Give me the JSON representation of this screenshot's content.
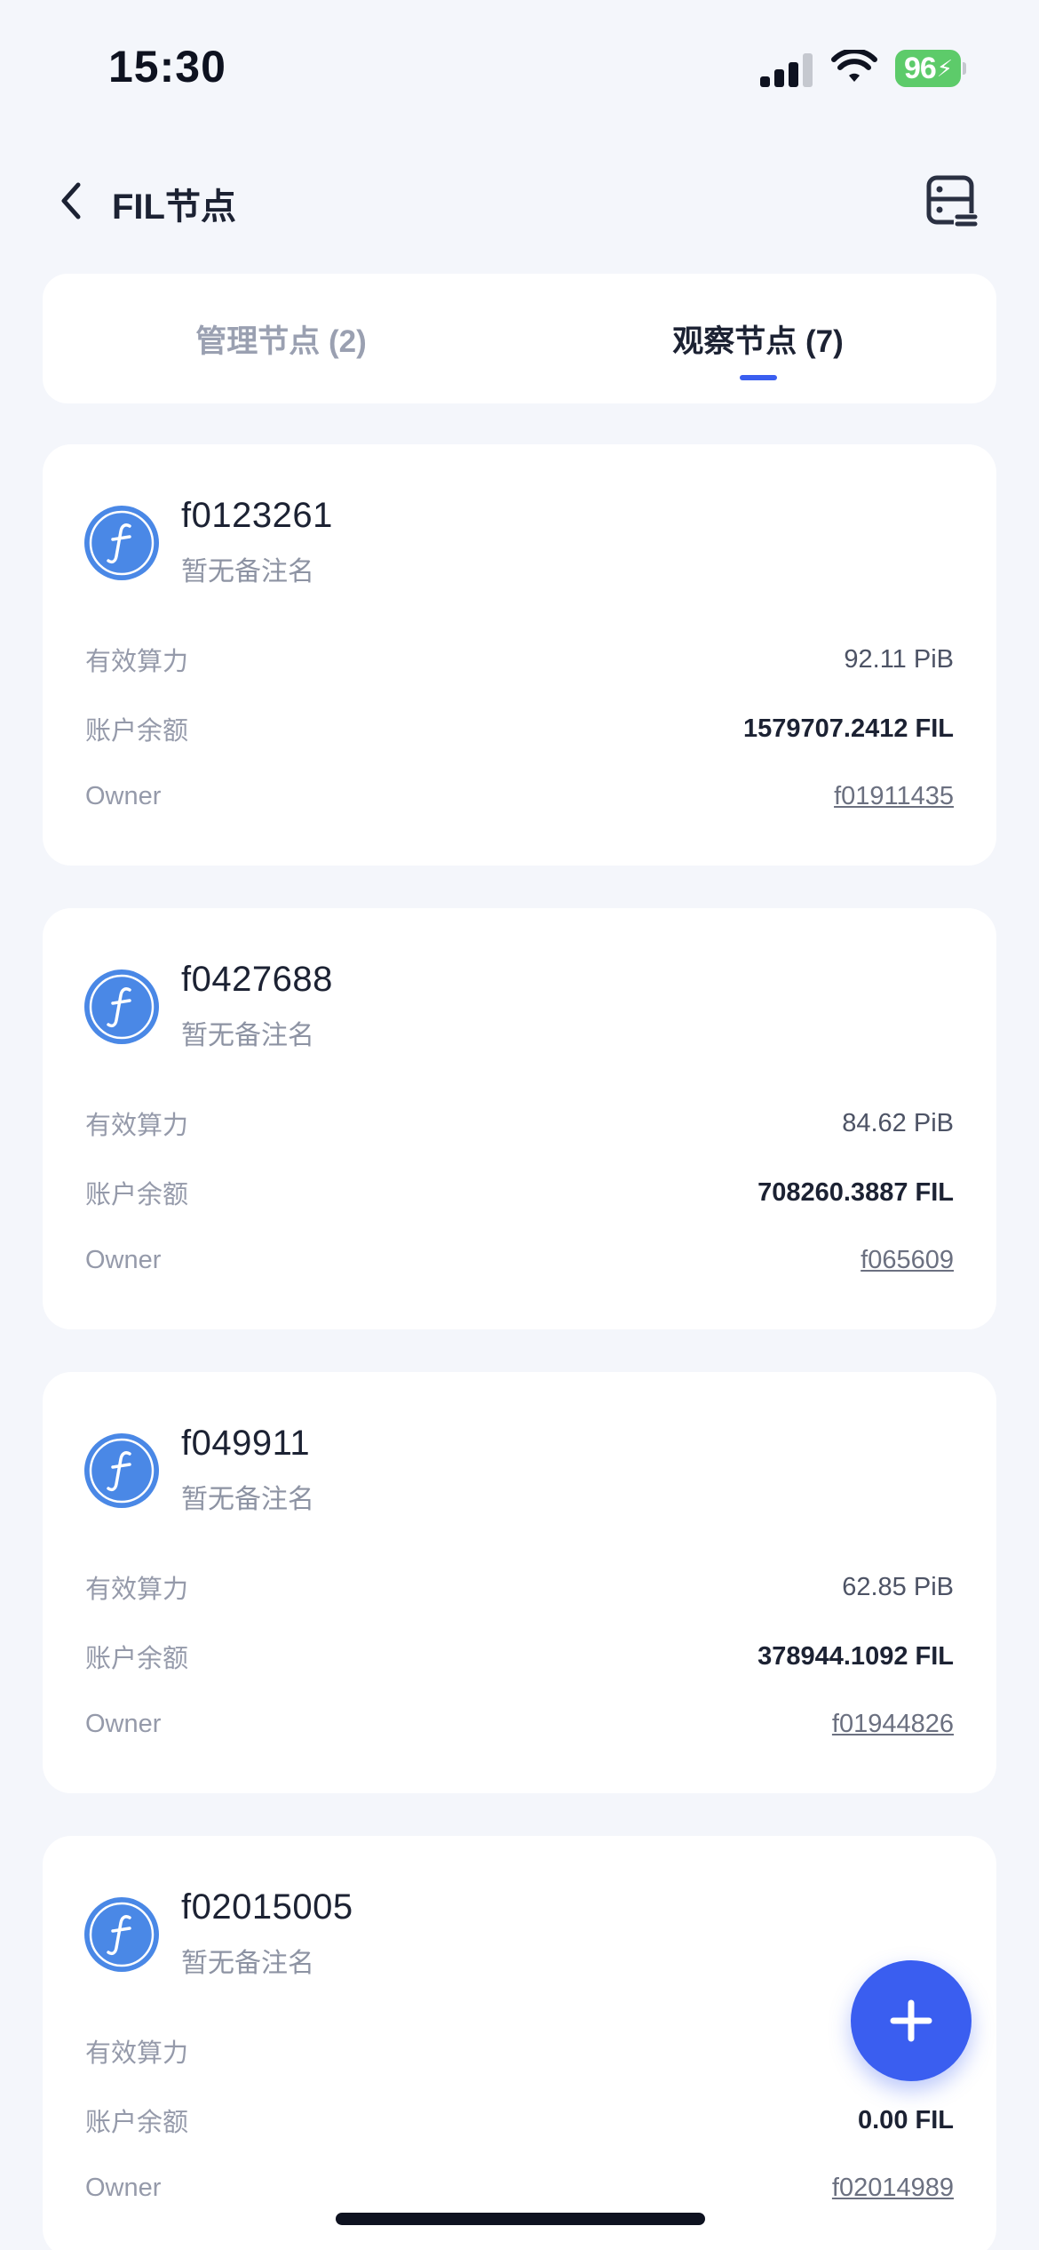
{
  "status_bar": {
    "time": "15:30",
    "battery": "96"
  },
  "header": {
    "title": "FIL节点"
  },
  "tabs": [
    {
      "label": "管理节点 (2)",
      "active": false
    },
    {
      "label": "观察节点 (7)",
      "active": true
    }
  ],
  "row_labels": {
    "power": "有效算力",
    "balance": "账户余额",
    "owner": "Owner"
  },
  "nodes": [
    {
      "id": "f0123261",
      "note": "暂无备注名",
      "power": "92.11 PiB",
      "balance": "1579707.2412 FIL",
      "owner": "f01911435"
    },
    {
      "id": "f0427688",
      "note": "暂无备注名",
      "power": "84.62 PiB",
      "balance": "708260.3887 FIL",
      "owner": "f065609"
    },
    {
      "id": "f049911",
      "note": "暂无备注名",
      "power": "62.85 PiB",
      "balance": "378944.1092 FIL",
      "owner": "f01944826"
    },
    {
      "id": "f02015005",
      "note": "暂无备注名",
      "power": "",
      "balance": "0.00 FIL",
      "owner": "f02014989"
    }
  ],
  "colors": {
    "accent": "#3a5ef0",
    "fil_logo": "#4a88e6",
    "battery": "#5dcb6a"
  },
  "icons": {
    "back": "chevron-left-icon",
    "node_list": "server-list-icon",
    "add": "plus-icon",
    "node_logo": "filecoin-logo-icon"
  }
}
